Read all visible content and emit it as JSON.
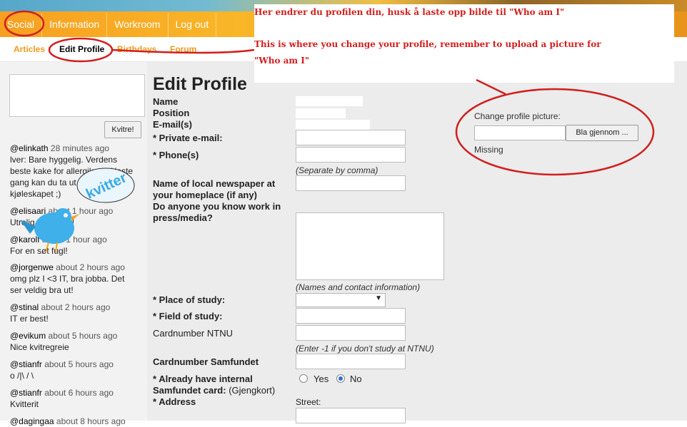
{
  "topnav": [
    "Social",
    "Information",
    "Workroom",
    "Log out"
  ],
  "subnav": [
    "Articles",
    "Edit Profile",
    "Birthdays",
    "Forum"
  ],
  "callout": {
    "line1": "Her endrer du profilen din, husk å laste opp bilde til \"Who am I\"",
    "line2a": "This is where you change your profile, remember to upload a picture for",
    "line2b": "\"Who am I\""
  },
  "sidebar": {
    "kvitre_label": "Kvitre!",
    "tweets": [
      {
        "user": "@elinkath",
        "time": "28 minutes ago",
        "text": [
          "lver: Bare hyggelig. Verdens",
          "beste kake for allergikere. Neste",
          "gang kan du ta ut formen av",
          "kjøleskapet ;)"
        ]
      },
      {
        "user": "@elisaari",
        "time": "about 1 hour ago",
        "text": [
          "Utrolig kult dette!"
        ]
      },
      {
        "user": "@karolf",
        "time": "about 1 hour ago",
        "text": [
          "For en søt fugl!"
        ]
      },
      {
        "user": "@jorgenwe",
        "time": "about 2 hours ago",
        "text": [
          "omg plz I <3 IT, bra jobba. Det",
          "ser veldig bra ut!"
        ]
      },
      {
        "user": "@stinal",
        "time": "about 2 hours ago",
        "text": [
          "IT er best!"
        ]
      },
      {
        "user": "@evikum",
        "time": "about 5 hours ago",
        "text": [
          "Nice kvitregreie"
        ]
      },
      {
        "user": "@stianfr",
        "time": "about 5 hours ago",
        "text": [
          "o /|\\ / \\"
        ]
      },
      {
        "user": "@stianfr",
        "time": "about 6 hours ago",
        "text": [
          "Kvitterit"
        ]
      },
      {
        "user": "@dagingaa",
        "time": "about 8 hours ago",
        "text": []
      }
    ]
  },
  "form": {
    "title": "Edit Profile",
    "name": "Name",
    "position": "Position",
    "emails": "E-mail(s)",
    "private_email": "* Private e-mail:",
    "phone": "* Phone(s)",
    "separate": "(Separate by comma)",
    "newspaper1": "Name of local newspaper at",
    "newspaper2": "your homeplace (if any)",
    "press1": "Do anyone you know work in",
    "press2": "press/media?",
    "names_hint": "(Names and contact information)",
    "place_of_study": "* Place of study:",
    "field_of_study": "* Field of study:",
    "card_ntnu": "Cardnumber NTNU",
    "ntnu_hint": "(Enter -1 if you don't study at NTNU)",
    "card_samf": "Cardnumber Samfundet",
    "internal1": "* Already have internal",
    "internal2": "Samfundet card:",
    "gjengkort": "(Gjengkort)",
    "yes": "Yes",
    "no": "No",
    "address": "* Address",
    "street": "Street:"
  },
  "picture": {
    "label": "Change profile picture:",
    "browse": "Bla gjennom ...",
    "status": "Missing"
  },
  "colors": {
    "accent": "#f39a1c",
    "annotation": "#d21e1e"
  }
}
